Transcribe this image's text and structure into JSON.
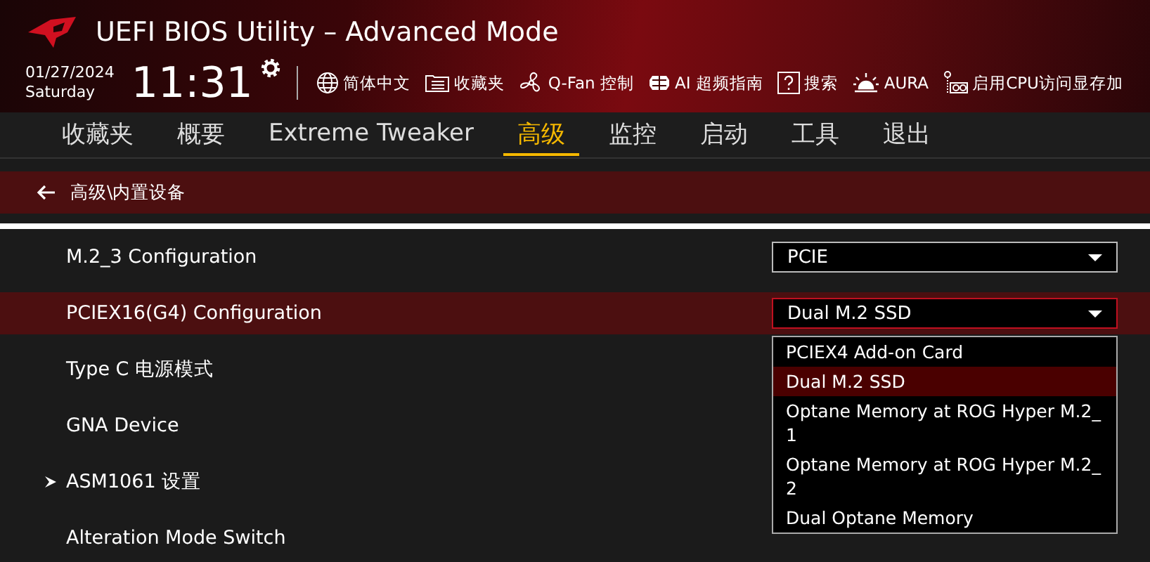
{
  "window": {
    "title": "UEFI BIOS Utility – Advanced Mode"
  },
  "status": {
    "date": "01/27/2024",
    "weekday": "Saturday",
    "time": "11:31"
  },
  "toolbar": [
    {
      "kind": "language",
      "label": "简体中文"
    },
    {
      "kind": "favorites",
      "label": "收藏夹"
    },
    {
      "kind": "fan",
      "label": "Q-Fan 控制"
    },
    {
      "kind": "ai",
      "label": "AI 超频指南"
    },
    {
      "kind": "search",
      "label": "搜索"
    },
    {
      "kind": "aura",
      "label": "AURA"
    },
    {
      "kind": "gpu",
      "label": "启用CPU访问显存加"
    }
  ],
  "tabs": [
    {
      "label": "收藏夹",
      "selected": false
    },
    {
      "label": "概要",
      "selected": false
    },
    {
      "label": "Extreme Tweaker",
      "selected": false
    },
    {
      "label": "高级",
      "selected": true
    },
    {
      "label": "监控",
      "selected": false
    },
    {
      "label": "启动",
      "selected": false
    },
    {
      "label": "工具",
      "selected": false
    },
    {
      "label": "退出",
      "selected": false
    }
  ],
  "breadcrumb": "高级\\内置设备",
  "rows": [
    {
      "kind": "setting",
      "label": "M.2_3 Configuration",
      "selected": false,
      "value": "PCIE"
    },
    {
      "kind": "setting",
      "label": "PCIEX16(G4) Configuration",
      "selected": true,
      "value": "Dual M.2 SSD",
      "options": [
        {
          "label": "PCIEX4 Add-on Card",
          "selected": false
        },
        {
          "label": "Dual M.2 SSD",
          "selected": true
        },
        {
          "label": "Optane Memory at ROG Hyper M.2_1",
          "selected": false
        },
        {
          "label": "Optane Memory at ROG Hyper M.2_2",
          "selected": false
        },
        {
          "label": "Dual Optane Memory",
          "selected": false
        }
      ]
    },
    {
      "kind": "plain",
      "label": "Type C 电源模式",
      "selected": false
    },
    {
      "kind": "plain",
      "label": "GNA Device",
      "selected": false
    },
    {
      "kind": "submenu",
      "label": "ASM1061 设置",
      "selected": false
    },
    {
      "kind": "plain",
      "label": "Alteration Mode Switch",
      "selected": false
    }
  ]
}
